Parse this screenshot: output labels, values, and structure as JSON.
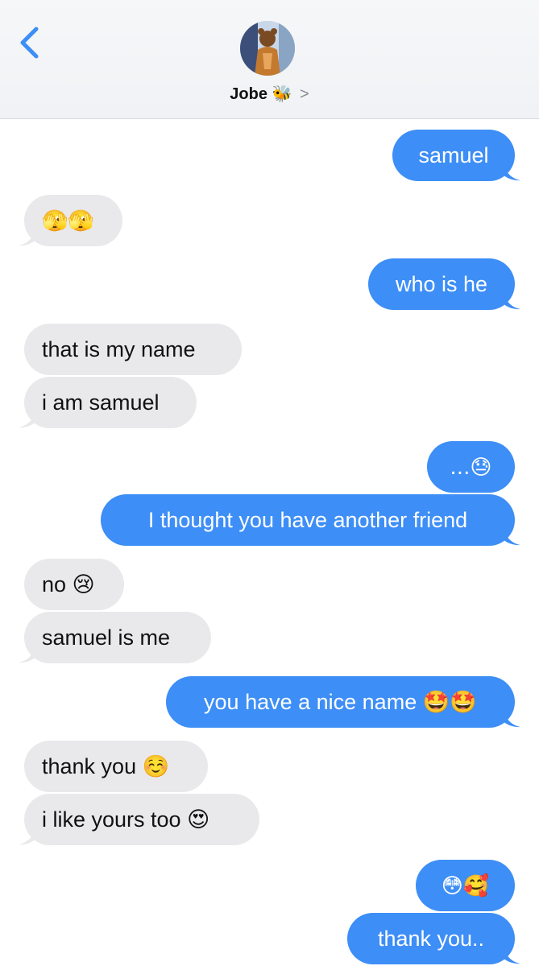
{
  "header": {
    "contact_name": "Jobe",
    "contact_emoji": "🐝",
    "chevron": ">",
    "back_icon": "chevron-left-icon"
  },
  "messages": [
    {
      "side": "out",
      "text": "samuel"
    },
    {
      "side": "in",
      "text": "🫣🫣"
    },
    {
      "side": "out",
      "text": "who is he"
    },
    {
      "side": "in",
      "text": "that is my name"
    },
    {
      "side": "in",
      "text": "i am samuel"
    },
    {
      "side": "out",
      "text": "...😓"
    },
    {
      "side": "out",
      "text": "I thought you have another friend"
    },
    {
      "side": "in",
      "text": "no 😢"
    },
    {
      "side": "in",
      "text": "samuel is me"
    },
    {
      "side": "out",
      "text": "you have a nice name 🤩🤩"
    },
    {
      "side": "in",
      "text": "thank you ☺️"
    },
    {
      "side": "in",
      "text": "i like yours too 😍"
    },
    {
      "side": "out",
      "text": "😳🥰"
    },
    {
      "side": "out",
      "text": "thank you.."
    }
  ],
  "colors": {
    "outgoing": "#3d8ef6",
    "incoming": "#e9e9eb",
    "back_accent": "#3d8ef6"
  }
}
